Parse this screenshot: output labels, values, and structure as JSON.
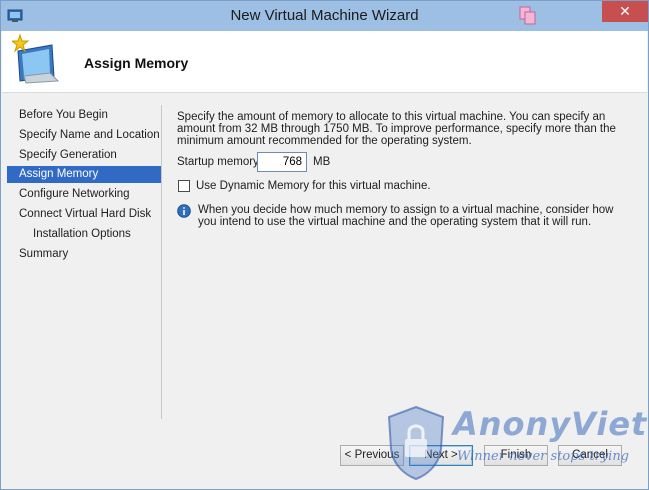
{
  "window": {
    "title": "New Virtual Machine Wizard",
    "close_label": "✕"
  },
  "header": {
    "heading": "Assign Memory"
  },
  "sidebar": {
    "items": [
      {
        "label": "Before You Begin"
      },
      {
        "label": "Specify Name and Location"
      },
      {
        "label": "Specify Generation"
      },
      {
        "label": "Assign Memory",
        "active": true
      },
      {
        "label": "Configure Networking"
      },
      {
        "label": "Connect Virtual Hard Disk"
      },
      {
        "label": "Installation Options",
        "sub": true
      },
      {
        "label": "Summary"
      }
    ]
  },
  "main": {
    "description": "Specify the amount of memory to allocate to this virtual machine. You can specify an amount from 32 MB through 1750 MB. To improve performance, specify more than the minimum amount recommended for the operating system.",
    "startup_memory_label": "Startup memory:",
    "startup_memory_value": "768",
    "startup_memory_unit": "MB",
    "dynamic_memory_label": "Use Dynamic Memory for this virtual machine.",
    "dynamic_memory_checked": false,
    "info_text": "When you decide how much memory to assign to a virtual machine, consider how you intend to use the virtual machine and the operating system that it will run."
  },
  "buttons": {
    "previous": "< Previous",
    "next": "Next >",
    "finish": "Finish",
    "cancel": "Cancel"
  },
  "watermark": {
    "name": "AnonyViet",
    "slogan": "Winner never stops trying"
  },
  "colors": {
    "titlebar": "#9dbfe3",
    "selection": "#316ac5",
    "close": "#c74f4f"
  }
}
